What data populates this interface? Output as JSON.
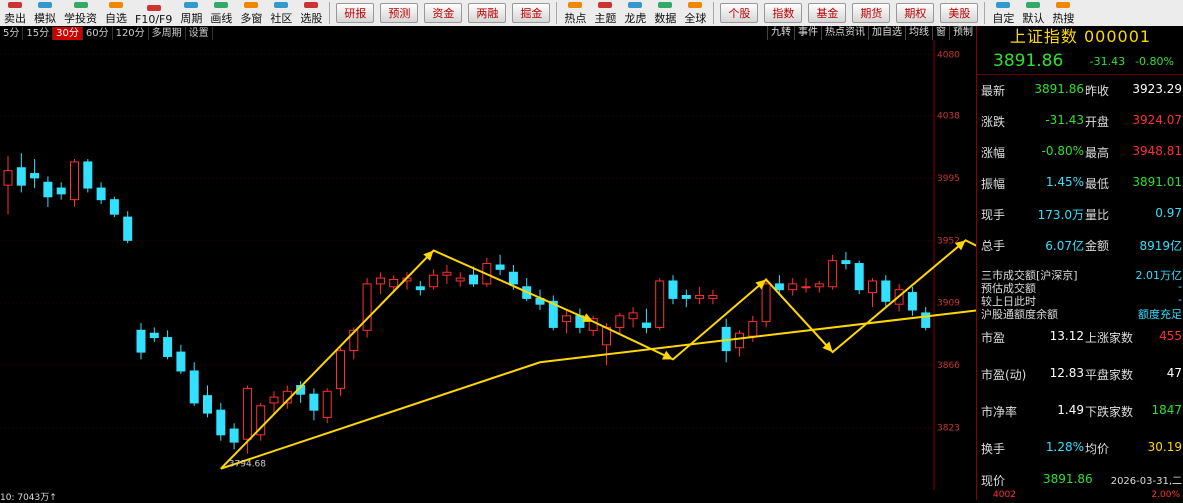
{
  "toolbar": {
    "items": [
      "卖出",
      "模拟",
      "学投资",
      "自选",
      "F10/F9",
      "周期",
      "画线",
      "多窗",
      "社区",
      "选股"
    ],
    "buttons": [
      "研报",
      "预测",
      "资金",
      "两融",
      "掘金"
    ],
    "items2": [
      "热点",
      "主题",
      "龙虎",
      "数据",
      "全球"
    ],
    "buttons2": [
      "个股",
      "指数",
      "基金",
      "期货",
      "期权",
      "美股"
    ],
    "items3": [
      "自定",
      "默认",
      "热搜"
    ]
  },
  "periods": [
    "5分",
    "15分",
    "30分",
    "60分",
    "120分",
    "多周期",
    "设置"
  ],
  "active_period": "30分",
  "right_tools": [
    "九转",
    "事件",
    "热点资讯",
    "加自选",
    "均线",
    "窗",
    "预制"
  ],
  "price_axis": [
    "4080",
    "4038",
    "3995",
    "3952",
    "3909",
    "3866",
    "3823"
  ],
  "annotations": {
    "low_label": "3794.68"
  },
  "bottom_label": "10: 7043万↑",
  "quote": {
    "title": "上证指数 000001",
    "price": "3891.86",
    "change": "-31.43",
    "change_pct": "-0.80%",
    "rows": [
      {
        "l": "最新",
        "v": "3891.86",
        "l2": "昨收",
        "v2": "3923.29"
      },
      {
        "l": "涨跌",
        "v": "-31.43",
        "l2": "开盘",
        "v2": "3924.07"
      },
      {
        "l": "涨幅",
        "v": "-0.80%",
        "l2": "最高",
        "v2": "3948.81"
      },
      {
        "l": "振幅",
        "v": "1.45%",
        "l2": "最低",
        "v2": "3891.01"
      },
      {
        "l": "现手",
        "v": "173.0万",
        "l2": "量比",
        "v2": "0.97"
      },
      {
        "l": "总手",
        "v": "6.07亿",
        "l2": "金额",
        "v2": "8919亿"
      }
    ],
    "market": [
      {
        "l": "三市成交额[沪深京]",
        "v": "2.01万亿"
      },
      {
        "l": "预估成交额",
        "v": "-"
      },
      {
        "l": "较上日此时",
        "v": "-"
      },
      {
        "l": "沪股通额度余额",
        "v": "额度充足"
      }
    ],
    "rows2": [
      {
        "l": "市盈",
        "v": "13.12",
        "l2": "上涨家数",
        "v2": "455"
      },
      {
        "l": "市盈(动)",
        "v": "12.83",
        "l2": "平盘家数",
        "v2": "47"
      },
      {
        "l": "市净率",
        "v": "1.49",
        "l2": "下跌家数",
        "v2": "1847"
      },
      {
        "l": "换手",
        "v": "1.28%",
        "l2": "均价",
        "v2": "30.19"
      }
    ],
    "footer": {
      "l": "现价",
      "v": "3891.86",
      "date": "2026-03-31,二",
      "axis_low": "4002",
      "pct_low": "2.00%"
    }
  },
  "chart_data": {
    "type": "candlestick",
    "ylim": [
      3780,
      4090
    ],
    "candles": [
      [
        3990,
        4010,
        3970,
        4000
      ],
      [
        4002,
        4012,
        3985,
        3990
      ],
      [
        3998,
        4008,
        3988,
        3995
      ],
      [
        3992,
        3996,
        3975,
        3982
      ],
      [
        3988,
        3992,
        3980,
        3984
      ],
      [
        3980,
        4008,
        3975,
        4006
      ],
      [
        4006,
        4008,
        3985,
        3988
      ],
      [
        3988,
        3992,
        3977,
        3980
      ],
      [
        3980,
        3982,
        3968,
        3970
      ],
      [
        3968,
        3972,
        3950,
        3952
      ],
      [
        3890,
        3895,
        3870,
        3875
      ],
      [
        3888,
        3892,
        3882,
        3885
      ],
      [
        3885,
        3890,
        3870,
        3872
      ],
      [
        3875,
        3880,
        3860,
        3862
      ],
      [
        3862,
        3868,
        3838,
        3840
      ],
      [
        3845,
        3852,
        3830,
        3833
      ],
      [
        3835,
        3840,
        3814,
        3818
      ],
      [
        3822,
        3826,
        3808,
        3813
      ],
      [
        3815,
        3852,
        3805,
        3850
      ],
      [
        3818,
        3840,
        3814,
        3838
      ],
      [
        3840,
        3848,
        3833,
        3844
      ],
      [
        3840,
        3852,
        3836,
        3848
      ],
      [
        3852,
        3855,
        3840,
        3846
      ],
      [
        3846,
        3850,
        3828,
        3835
      ],
      [
        3830,
        3850,
        3826,
        3848
      ],
      [
        3850,
        3878,
        3845,
        3876
      ],
      [
        3876,
        3892,
        3870,
        3890
      ],
      [
        3890,
        3926,
        3885,
        3922
      ],
      [
        3922,
        3930,
        3915,
        3926
      ],
      [
        3920,
        3928,
        3916,
        3925
      ],
      [
        3924,
        3930,
        3918,
        3926
      ],
      [
        3920,
        3924,
        3914,
        3918
      ],
      [
        3920,
        3932,
        3918,
        3928
      ],
      [
        3928,
        3935,
        3922,
        3930
      ],
      [
        3924,
        3930,
        3920,
        3926
      ],
      [
        3928,
        3934,
        3920,
        3922
      ],
      [
        3922,
        3940,
        3920,
        3936
      ],
      [
        3935,
        3942,
        3928,
        3932
      ],
      [
        3930,
        3935,
        3918,
        3922
      ],
      [
        3920,
        3926,
        3910,
        3912
      ],
      [
        3912,
        3918,
        3904,
        3908
      ],
      [
        3910,
        3914,
        3890,
        3892
      ],
      [
        3896,
        3904,
        3888,
        3900
      ],
      [
        3900,
        3905,
        3888,
        3892
      ],
      [
        3890,
        3900,
        3886,
        3898
      ],
      [
        3880,
        3895,
        3866,
        3892
      ],
      [
        3892,
        3902,
        3888,
        3900
      ],
      [
        3898,
        3906,
        3892,
        3902
      ],
      [
        3895,
        3905,
        3888,
        3892
      ],
      [
        3892,
        3926,
        3890,
        3924
      ],
      [
        3924,
        3928,
        3908,
        3912
      ],
      [
        3914,
        3918,
        3906,
        3912
      ],
      [
        3912,
        3920,
        3908,
        3914
      ],
      [
        3912,
        3918,
        3908,
        3914
      ],
      [
        3892,
        3898,
        3868,
        3876
      ],
      [
        3878,
        3890,
        3872,
        3888
      ],
      [
        3886,
        3900,
        3882,
        3896
      ],
      [
        3896,
        3926,
        3892,
        3922
      ],
      [
        3922,
        3928,
        3914,
        3918
      ],
      [
        3918,
        3926,
        3914,
        3922
      ],
      [
        3920,
        3926,
        3916,
        3920
      ],
      [
        3920,
        3924,
        3916,
        3922
      ],
      [
        3920,
        3942,
        3918,
        3938
      ],
      [
        3938,
        3944,
        3932,
        3936
      ],
      [
        3936,
        3938,
        3915,
        3918
      ],
      [
        3916,
        3926,
        3906,
        3924
      ],
      [
        3924,
        3928,
        3906,
        3910
      ],
      [
        3908,
        3922,
        3903,
        3918
      ],
      [
        3916,
        3920,
        3900,
        3904
      ],
      [
        3902,
        3906,
        3890,
        3892
      ]
    ],
    "trend_points": [
      [
        16,
        3794.68
      ],
      [
        32,
        3945
      ],
      [
        44,
        3896
      ],
      [
        50,
        3870
      ],
      [
        57,
        3925
      ],
      [
        62,
        3875
      ],
      [
        72,
        3952
      ],
      [
        79,
        3920
      ],
      [
        81,
        3892
      ],
      [
        90,
        3910
      ],
      [
        93,
        3935
      ],
      [
        96,
        3960
      ],
      [
        100,
        3955
      ],
      [
        109,
        3830
      ]
    ],
    "support_line": [
      [
        16,
        3794.68
      ],
      [
        40,
        3868
      ],
      [
        74,
        3905
      ]
    ]
  }
}
